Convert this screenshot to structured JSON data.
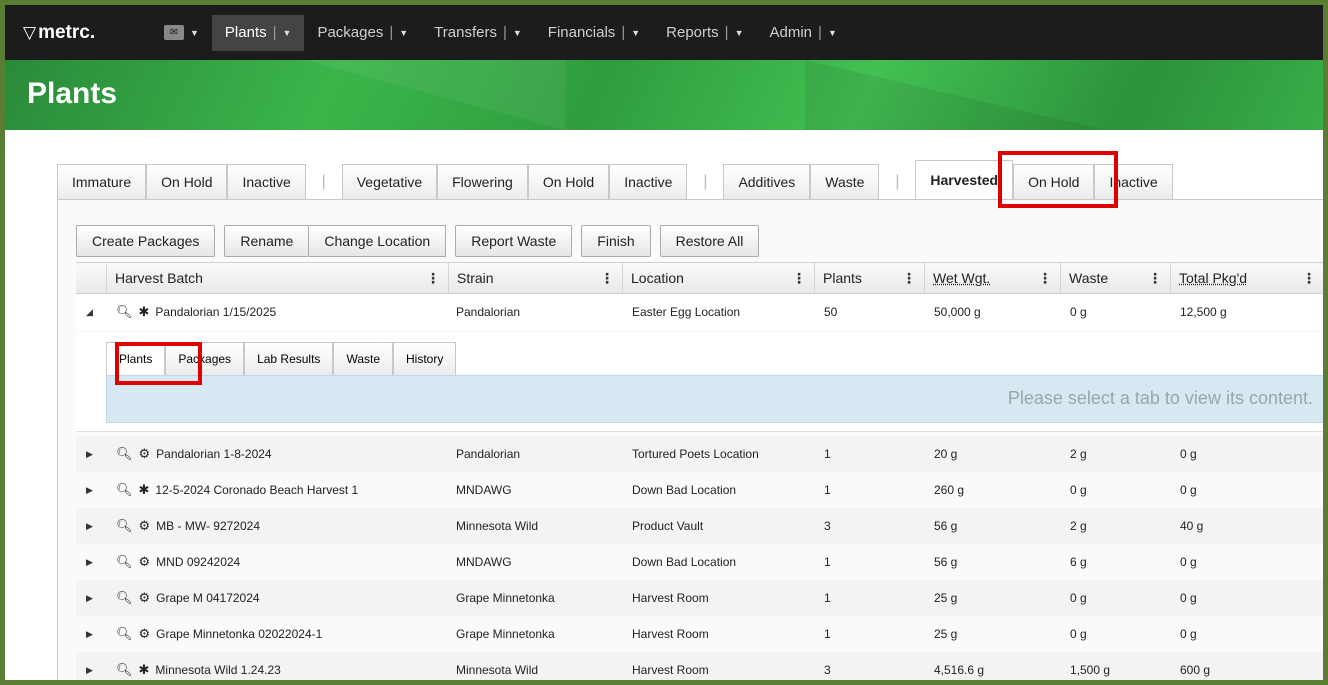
{
  "nav": {
    "logo": "metrc.",
    "items": [
      {
        "label": "Plants",
        "active": true
      },
      {
        "label": "Packages"
      },
      {
        "label": "Transfers"
      },
      {
        "label": "Financials"
      },
      {
        "label": "Reports"
      },
      {
        "label": "Admin"
      }
    ]
  },
  "page_title": "Plants",
  "main_tabs": {
    "group1": [
      "Immature",
      "On Hold",
      "Inactive"
    ],
    "group2": [
      "Vegetative",
      "Flowering",
      "On Hold",
      "Inactive"
    ],
    "group3": [
      "Additives",
      "Waste"
    ],
    "group4": [
      "Harvested",
      "On Hold",
      "Inactive"
    ],
    "active": "Harvested"
  },
  "toolbar": {
    "create_packages": "Create Packages",
    "rename": "Rename",
    "change_location": "Change Location",
    "report_waste": "Report Waste",
    "finish": "Finish",
    "restore_all": "Restore All"
  },
  "columns": [
    "Harvest Batch",
    "Strain",
    "Location",
    "Plants",
    "Wet Wgt.",
    "Waste",
    "Total Pkg'd"
  ],
  "expanded_row": {
    "batch": "Pandalorian 1/15/2025",
    "strain": "Pandalorian",
    "location": "Easter Egg Location",
    "plants": "50",
    "wet": "50,000 g",
    "waste": "0 g",
    "pkgd": "12,500 g"
  },
  "sub_tabs": [
    "Plants",
    "Packages",
    "Lab Results",
    "Waste",
    "History"
  ],
  "sub_message": "Please select a tab to view its content.",
  "rows": [
    {
      "batch": "Pandalorian 1-8-2024",
      "icon": "gear",
      "strain": "Pandalorian",
      "location": "Tortured Poets Location",
      "plants": "1",
      "wet": "20 g",
      "waste": "2 g",
      "pkgd": "0 g"
    },
    {
      "batch": "12-5-2024 Coronado Beach Harvest 1",
      "icon": "asterisk",
      "strain": "MNDAWG",
      "location": "Down Bad Location",
      "plants": "1",
      "wet": "260 g",
      "waste": "0 g",
      "pkgd": "0 g"
    },
    {
      "batch": "MB - MW- 9272024",
      "icon": "gear",
      "strain": "Minnesota Wild",
      "location": "Product Vault",
      "plants": "3",
      "wet": "56 g",
      "waste": "2 g",
      "pkgd": "40 g"
    },
    {
      "batch": "MND 09242024",
      "icon": "gear",
      "strain": "MNDAWG",
      "location": "Down Bad Location",
      "plants": "1",
      "wet": "56 g",
      "waste": "6 g",
      "pkgd": "0 g"
    },
    {
      "batch": "Grape M 04172024",
      "icon": "gear",
      "strain": "Grape Minnetonka",
      "location": "Harvest Room",
      "plants": "1",
      "wet": "25 g",
      "waste": "0 g",
      "pkgd": "0 g"
    },
    {
      "batch": "Grape Minnetonka 02022024-1",
      "icon": "gear",
      "strain": "Grape Minnetonka",
      "location": "Harvest Room",
      "plants": "1",
      "wet": "25 g",
      "waste": "0 g",
      "pkgd": "0 g"
    },
    {
      "batch": "Minnesota Wild 1.24.23",
      "icon": "asterisk",
      "strain": "Minnesota Wild",
      "location": "Harvest Room",
      "plants": "3",
      "wet": "4,516.6 g",
      "waste": "1,500 g",
      "pkgd": "600 g"
    }
  ]
}
